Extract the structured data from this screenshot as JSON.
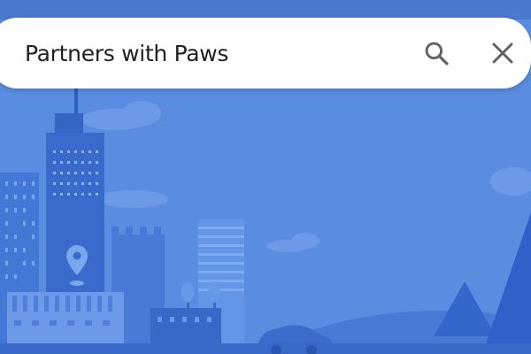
{
  "search": {
    "query": "Partners with Paws",
    "search_icon": "search-icon",
    "clear_icon": "close-icon"
  },
  "colors": {
    "background": "#5a8de0",
    "building": "#3f6fd0",
    "building_light": "#6a9ae8",
    "tower_dark": "#3566c6",
    "mountain": "#3b6bd1",
    "hill": "#2f5dbd",
    "search_bar": "#ffffff",
    "text": "#202124",
    "icon": "#5f6368"
  }
}
